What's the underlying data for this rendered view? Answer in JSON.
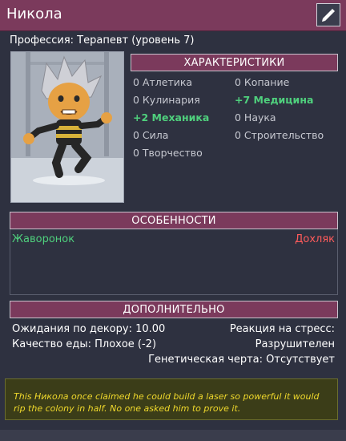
{
  "window": {
    "title": "Никола"
  },
  "profession": "Профессия: Терапевт (уровень 7)",
  "attributes": {
    "header": "ХАРАКТЕРИСТИКИ",
    "items": [
      {
        "label": "0 Атлетика",
        "positive": false
      },
      {
        "label": "0 Копание",
        "positive": false
      },
      {
        "label": "0 Кулинария",
        "positive": false
      },
      {
        "label": "+7 Медицина",
        "positive": true
      },
      {
        "label": "+2 Механика",
        "positive": true
      },
      {
        "label": "0 Наука",
        "positive": false
      },
      {
        "label": "0 Сила",
        "positive": false
      },
      {
        "label": "0 Строительство",
        "positive": false
      },
      {
        "label": "0 Творчество",
        "positive": false
      }
    ]
  },
  "traits": {
    "header": "ОСОБЕННОСТИ",
    "positive": "Жаворонок",
    "negative": "Дохляк"
  },
  "extra": {
    "header": "ДОПОЛНИТЕЛЬНО",
    "decor_expectation": "Ожидания по декору: 10.00",
    "food_quality": "Качество еды: Плохое (-2)",
    "stress_reaction_label": "Реакция на стресс:",
    "stress_reaction_value": "Разрушителен",
    "genetic_trait": "Генетическая черта: Отсутствует"
  },
  "flavor_text": "This Никола once claimed he could build a laser so powerful it would rip the colony in half. No one asked him to prove it.",
  "colors": {
    "header_bg": "#7b3a5c",
    "panel_bg": "#2e3140",
    "positive": "#4fd07d",
    "negative": "#ff5b5b",
    "flavor_text": "#f0d92c"
  },
  "icons": {
    "edit": "pencil-icon"
  }
}
